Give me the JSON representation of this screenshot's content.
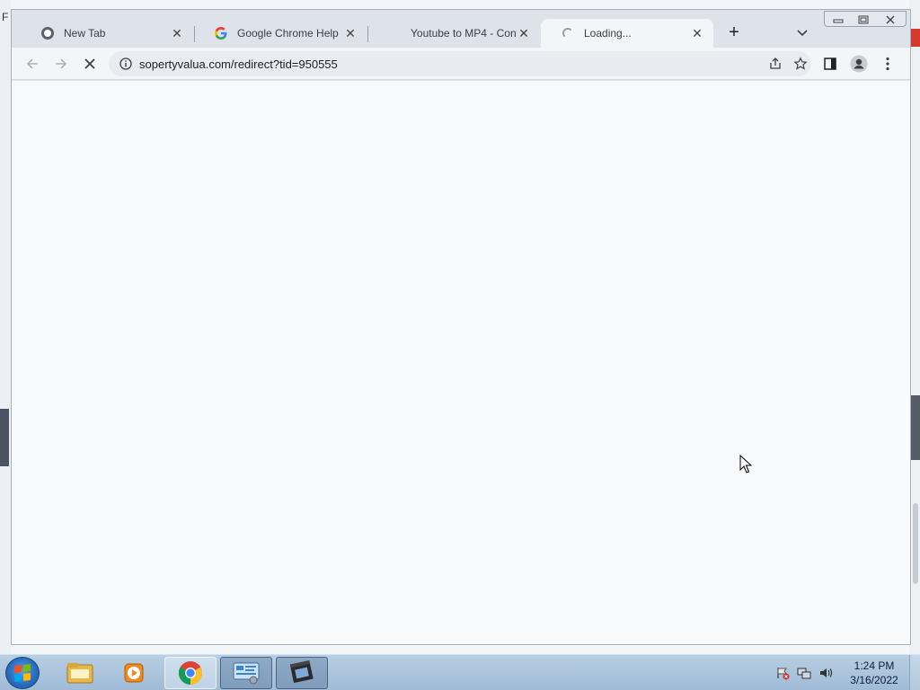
{
  "browser": {
    "tabs": [
      {
        "title": "New Tab",
        "favicon": "chrome-icon",
        "active": false
      },
      {
        "title": "Google Chrome Help",
        "favicon": "google-g-icon",
        "active": false
      },
      {
        "title": "Youtube to MP4 - Conve",
        "favicon": "blank-favicon",
        "active": false
      },
      {
        "title": "Loading...",
        "favicon": "loading-spinner-icon",
        "active": true
      }
    ],
    "new_tab_symbol": "+",
    "close_symbol": "✕",
    "url": "sopertyvalua.com/redirect?tid=950555"
  },
  "taskbar": {
    "clock_time": "1:24 PM",
    "clock_date": "3/16/2022",
    "pinned_apps": [
      "explorer",
      "media-player",
      "chrome",
      "control-panel",
      "movie-maker"
    ]
  },
  "colors": {
    "taskbar": "#a8c3dc",
    "page_background": "#f7f9fb",
    "tab_strip": "#dee3ea"
  }
}
